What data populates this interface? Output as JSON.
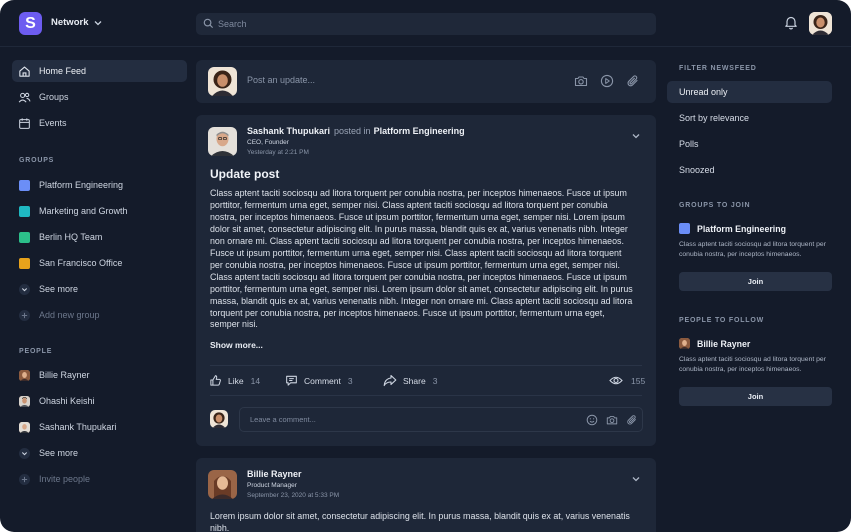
{
  "workspace": {
    "name": "Network",
    "logo_letter": "S",
    "accent": "#6d5cf0"
  },
  "search": {
    "placeholder": "Search"
  },
  "nav": [
    {
      "label": "Home Feed",
      "icon": "home-icon"
    },
    {
      "label": "Groups",
      "icon": "users-icon"
    },
    {
      "label": "Events",
      "icon": "calendar-icon"
    }
  ],
  "groups_section": {
    "label": "GROUPS",
    "items": [
      {
        "label": "Platform Engineering",
        "color": "#6b8ef7"
      },
      {
        "label": "Marketing and Growth",
        "color": "#1fb8c2"
      },
      {
        "label": "Berlin HQ Team",
        "color": "#2cbf8a"
      },
      {
        "label": "San Francisco Office",
        "color": "#e7a21b"
      }
    ],
    "see_more": "See more",
    "add": "Add new group"
  },
  "people_section": {
    "label": "PEOPLE",
    "items": [
      {
        "label": "Billie Rayner"
      },
      {
        "label": "Ohashi Keishi"
      },
      {
        "label": "Sashank Thupukari"
      }
    ],
    "see_more": "See more",
    "invite": "Invite people"
  },
  "composer": {
    "placeholder": "Post an update..."
  },
  "post1": {
    "author": "Sashank Thupukari",
    "posted_in": "posted in",
    "group": "Platform Engineering",
    "role": "CEO, Founder",
    "time": "Yesterday at 2:21 PM",
    "title": "Update post",
    "body": "Class aptent taciti sociosqu ad litora torquent per conubia nostra, per inceptos himenaeos. Fusce ut ipsum porttitor, fermentum urna eget, semper nisi. Class aptent taciti sociosqu ad litora torquent per conubia nostra, per inceptos himenaeos. Fusce ut ipsum porttitor, fermentum urna eget, semper nisi. Lorem ipsum dolor sit amet, consectetur adipiscing elit. In purus massa, blandit quis ex at, varius venenatis nibh. Integer non ornare mi. Class aptent taciti sociosqu ad litora torquent per conubia nostra, per inceptos himenaeos. Fusce ut ipsum porttitor, fermentum urna eget, semper nisi. Class aptent taciti sociosqu ad litora torquent per conubia nostra, per inceptos himenaeos. Fusce ut ipsum porttitor, fermentum urna eget, semper nisi. Class aptent taciti sociosqu ad litora torquent per conubia nostra, per inceptos himenaeos. Fusce ut ipsum porttitor, fermentum urna eget, semper nisi. Lorem ipsum dolor sit amet, consectetur adipiscing elit. In purus massa, blandit quis ex at, varius venenatis nibh. Integer non ornare mi. Class aptent taciti sociosqu ad litora torquent per conubia nostra, per inceptos himenaeos. Fusce ut ipsum porttitor, fermentum urna eget, semper nisi.",
    "show_more": "Show more...",
    "like_label": "Like",
    "like_count": "14",
    "comment_label": "Comment",
    "comment_count": "3",
    "share_label": "Share",
    "share_count": "3",
    "views": "155",
    "comment_placeholder": "Leave a comment..."
  },
  "post2": {
    "author": "Billie Rayner",
    "role": "Product Manager",
    "time": "September 23, 2020 at 5:33 PM",
    "body": "Lorem ipsum dolor sit amet, consectetur adipiscing elit. In purus massa, blandit quis ex at, varius venenatis nibh."
  },
  "right": {
    "filter_label": "FILTER NEWSFEED",
    "filters": [
      "Unread only",
      "Sort by relevance",
      "Polls",
      "Snoozed"
    ],
    "groups_label": "GROUPS TO JOIN",
    "group_suggestion": {
      "name": "Platform Engineering",
      "color": "#6b8ef7",
      "desc": "Class aptent taciti sociosqu ad litora torquent per conubia nostra, per inceptos himenaeos.",
      "join": "Join"
    },
    "people_label": "PEOPLE TO FOLLOW",
    "person_suggestion": {
      "name": "Billie Rayner",
      "desc": "Class aptent taciti sociosqu ad litora torquent per conubia nostra, per inceptos himenaeos.",
      "join": "Join"
    }
  }
}
